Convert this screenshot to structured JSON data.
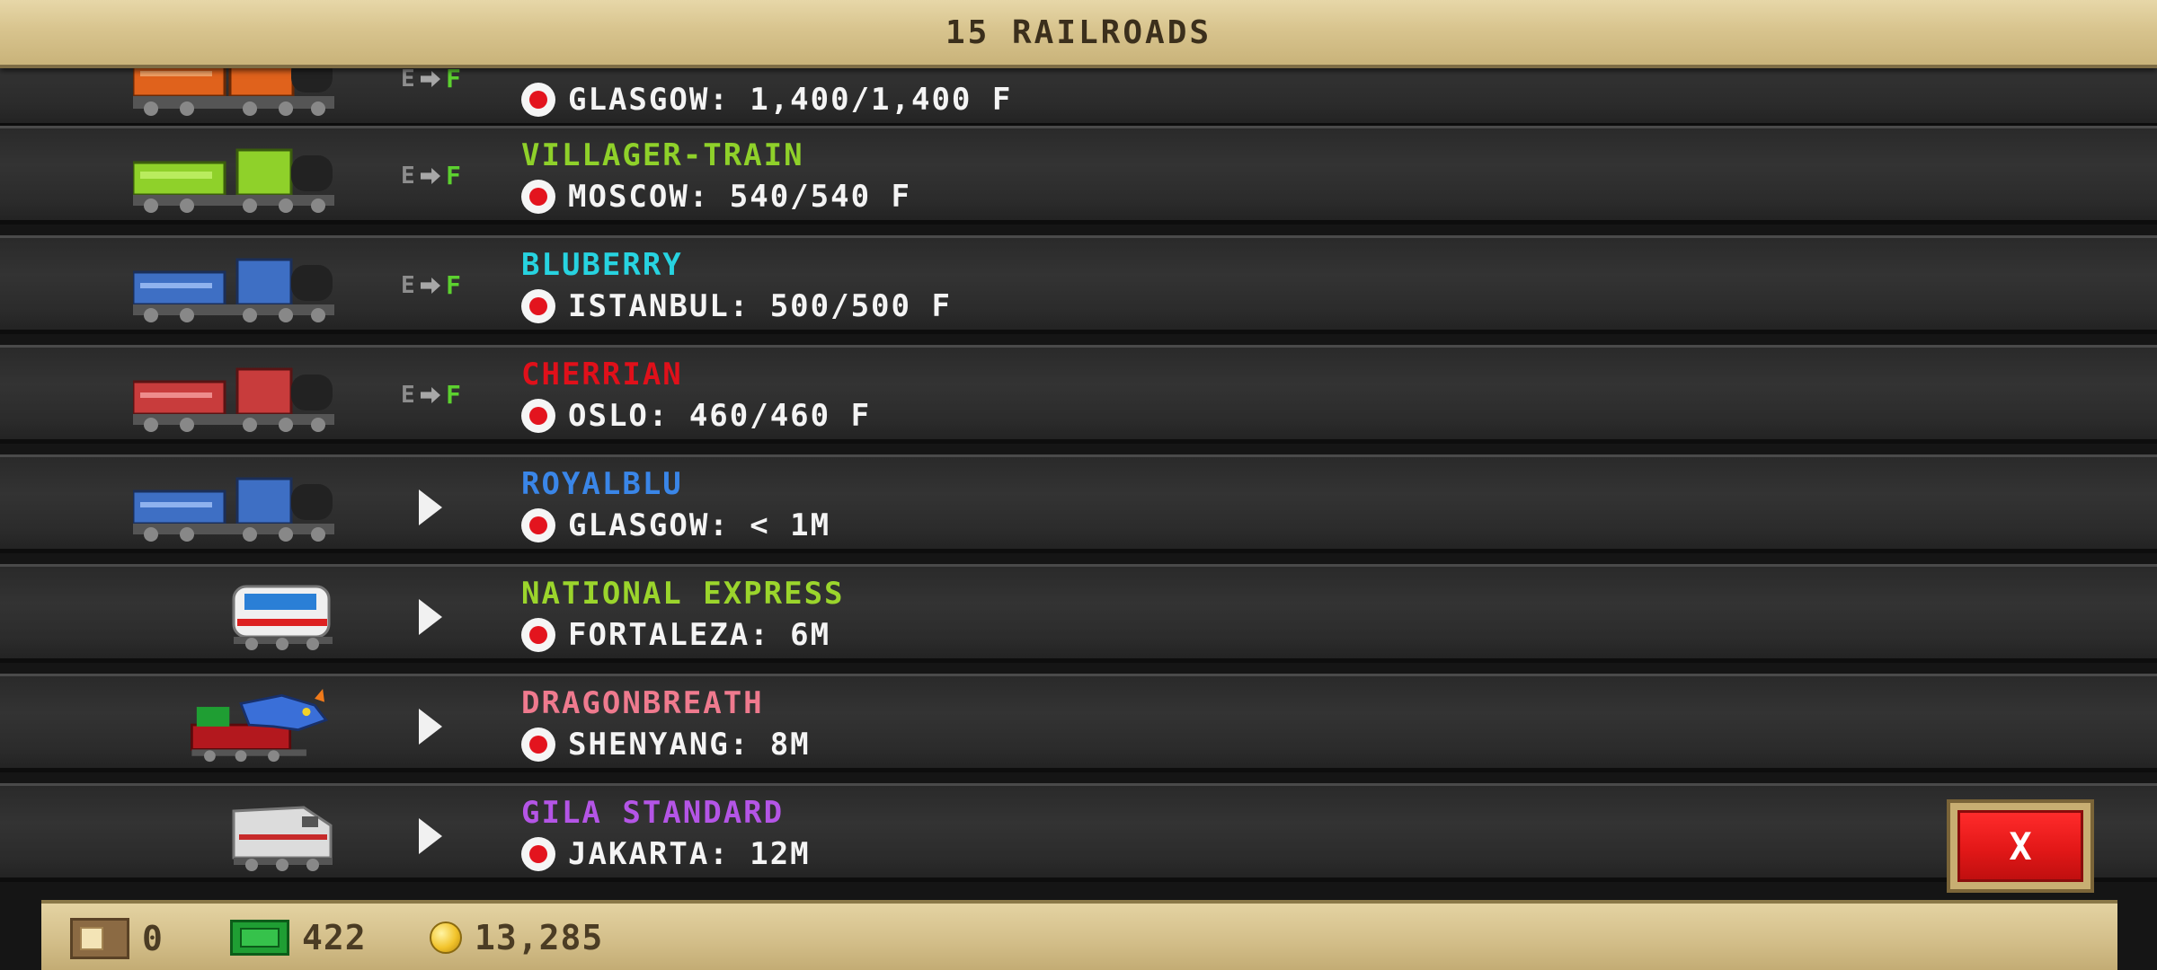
{
  "header": {
    "title": "15 RAILROADS"
  },
  "rows": [
    {
      "name": "",
      "name_color": "#ffffff",
      "destination": "GLASGOW: 1,400/1,400 F",
      "status": "full",
      "train": "orange-steam"
    },
    {
      "name": "VILLAGER-TRAIN",
      "name_color": "#8fd12a",
      "destination": "MOSCOW: 540/540 F",
      "status": "full",
      "train": "green-steam"
    },
    {
      "name": "BLUBERRY",
      "name_color": "#27d3e0",
      "destination": "ISTANBUL: 500/500 F",
      "status": "full",
      "train": "blue-steam"
    },
    {
      "name": "CHERRIAN",
      "name_color": "#e0101a",
      "destination": "OSLO: 460/460 F",
      "status": "full",
      "train": "red-steam"
    },
    {
      "name": "ROYALBLU",
      "name_color": "#3a86e8",
      "destination": "GLASGOW: < 1M",
      "status": "go",
      "train": "blue-steam"
    },
    {
      "name": "NATIONAL EXPRESS",
      "name_color": "#9bd52c",
      "destination": "FORTALEZA: 6M",
      "status": "go",
      "train": "white-diesel"
    },
    {
      "name": "DRAGONBREATH",
      "name_color": "#ef7a8e",
      "destination": "SHENYANG: 8M",
      "status": "go",
      "train": "dragon"
    },
    {
      "name": "GILA STANDARD",
      "name_color": "#b455e6",
      "destination": "JAKARTA: 12M",
      "status": "go",
      "train": "silver-diesel"
    }
  ],
  "status_labels": {
    "empty": "E",
    "full": "F"
  },
  "close_button": {
    "label": "X"
  },
  "footer": {
    "tickets": "0",
    "cash": "422",
    "coins": "13,285"
  }
}
